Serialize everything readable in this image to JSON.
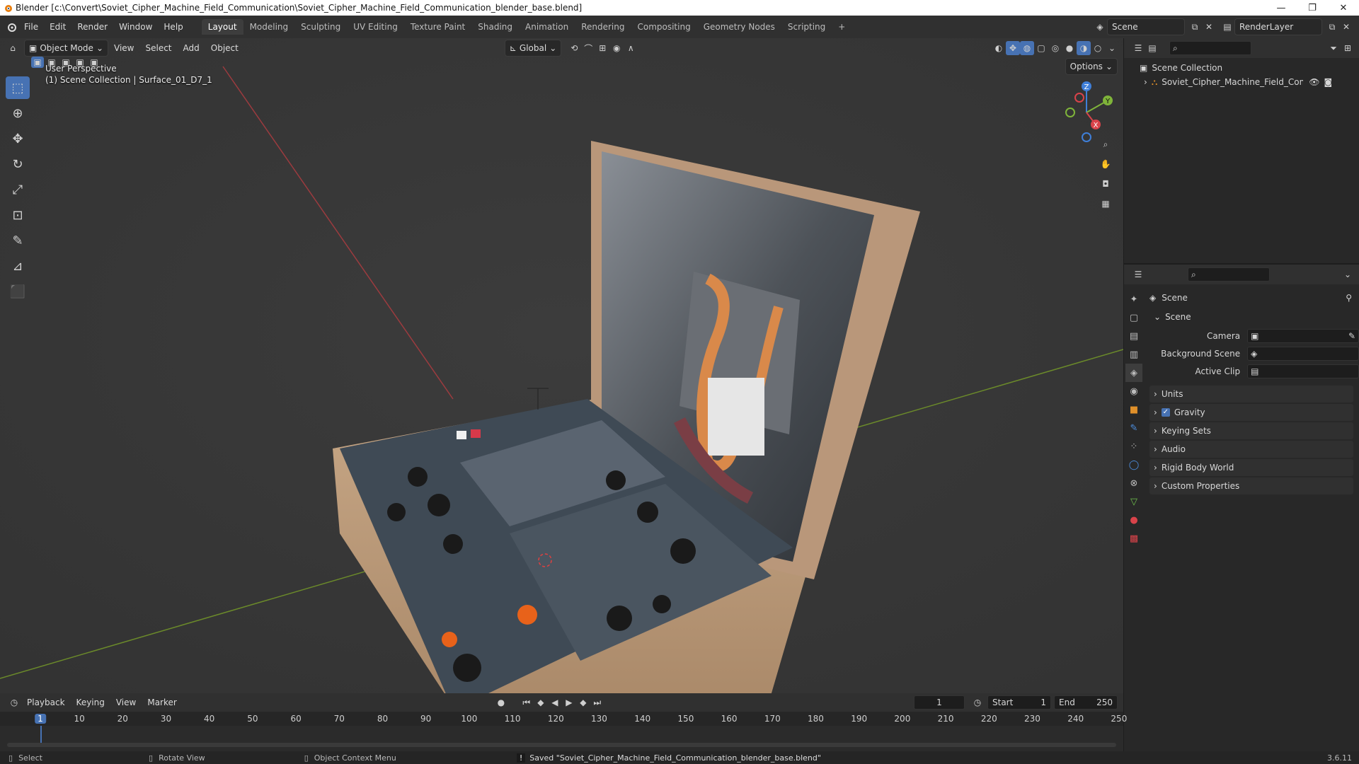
{
  "window": {
    "title": "Blender [c:\\Convert\\Soviet_Cipher_Machine_Field_Communication\\Soviet_Cipher_Machine_Field_Communication_blender_base.blend]",
    "minimize": "—",
    "maximize": "❐",
    "close": "✕"
  },
  "menu": [
    "File",
    "Edit",
    "Render",
    "Window",
    "Help"
  ],
  "workspaces": [
    "Layout",
    "Modeling",
    "Sculpting",
    "UV Editing",
    "Texture Paint",
    "Shading",
    "Animation",
    "Rendering",
    "Compositing",
    "Geometry Nodes",
    "Scripting"
  ],
  "workspace_add": "+",
  "scene_selector": "Scene",
  "render_layer": "RenderLayer",
  "viewport_header": {
    "mode": "Object Mode",
    "menus": [
      "View",
      "Select",
      "Add",
      "Object"
    ],
    "orientation": "Global",
    "options": "Options"
  },
  "viewport_overlay": {
    "line1": "User Perspective",
    "line2": "(1) Scene Collection | Surface_01_D7_1"
  },
  "gizmo": {
    "z": "Z",
    "y": "Y",
    "x": "X"
  },
  "outliner": {
    "root": "Scene Collection",
    "item": "Soviet_Cipher_Machine_Field_Communi"
  },
  "properties": {
    "context": "Scene",
    "section": "Scene",
    "camera_label": "Camera",
    "background_label": "Background Scene",
    "clip_label": "Active Clip",
    "panels": [
      "Units",
      "Gravity",
      "Keying Sets",
      "Audio",
      "Rigid Body World",
      "Custom Properties"
    ]
  },
  "timeline": {
    "menus": [
      "Playback",
      "Keying",
      "View",
      "Marker"
    ],
    "current_frame": "1",
    "start_label": "Start",
    "start": "1",
    "end_label": "End",
    "end": "250",
    "ticks": [
      "1",
      "10",
      "20",
      "30",
      "40",
      "50",
      "60",
      "70",
      "80",
      "90",
      "100",
      "110",
      "120",
      "130",
      "140",
      "150",
      "160",
      "170",
      "180",
      "190",
      "200",
      "210",
      "220",
      "230",
      "240",
      "250"
    ]
  },
  "statusbar": {
    "select": "Select",
    "rotate": "Rotate View",
    "context_menu": "Object Context Menu",
    "message": "Saved \"Soviet_Cipher_Machine_Field_Communication_blender_base.blend\"",
    "version": "3.6.11"
  },
  "colors": {
    "accent": "#4772b3",
    "x_axis": "#d9434a",
    "y_axis": "#7fb43a",
    "z_axis": "#3f7fd9"
  }
}
